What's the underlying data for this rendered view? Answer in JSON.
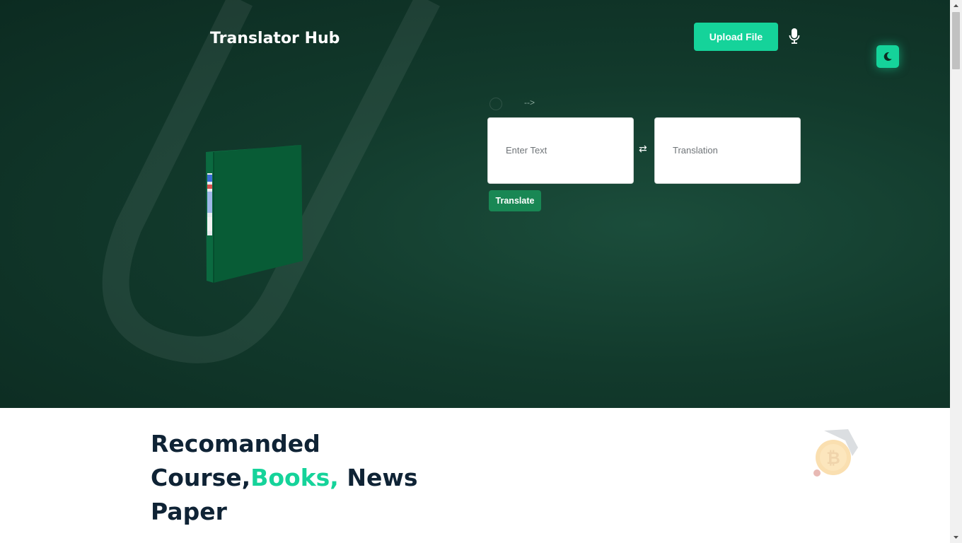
{
  "header": {
    "brand": "Translator Hub",
    "upload_label": "Upload File",
    "mic_icon": "microphone-icon",
    "theme_icon": "moon-icon"
  },
  "translator": {
    "comment_arrow": "-->",
    "input_placeholder": "Enter Text",
    "output_placeholder": "Translation",
    "swap_icon": "⇄",
    "translate_label": "Translate"
  },
  "hero_image": "green-binder-image",
  "recommend": {
    "line1": "Recomanded",
    "line2_a": "Course,",
    "line2_b": "Books,",
    "line2_c": " News",
    "line3": "Paper",
    "image": "bitcoin-coin-image"
  },
  "colors": {
    "accent": "#15d39a",
    "translate_button": "#198754",
    "hero_dark": "#0c2b21",
    "heading": "#0f2335"
  }
}
